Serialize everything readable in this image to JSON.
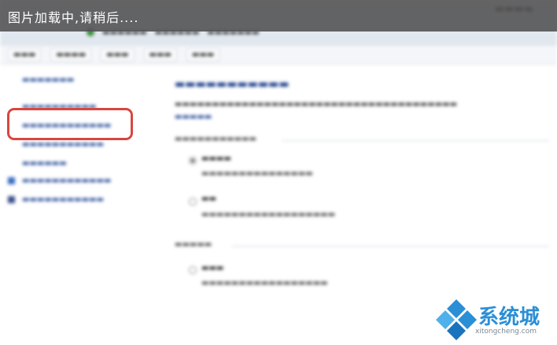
{
  "overlay": {
    "loading_text": "图片加载中,请稍后...."
  },
  "watermark": {
    "brand_text": "系统城",
    "url_text": "xitongcheng.com"
  },
  "colors": {
    "highlight": "#d9463f",
    "link": "#2a4f9a",
    "heading": "#1d3f8a"
  }
}
